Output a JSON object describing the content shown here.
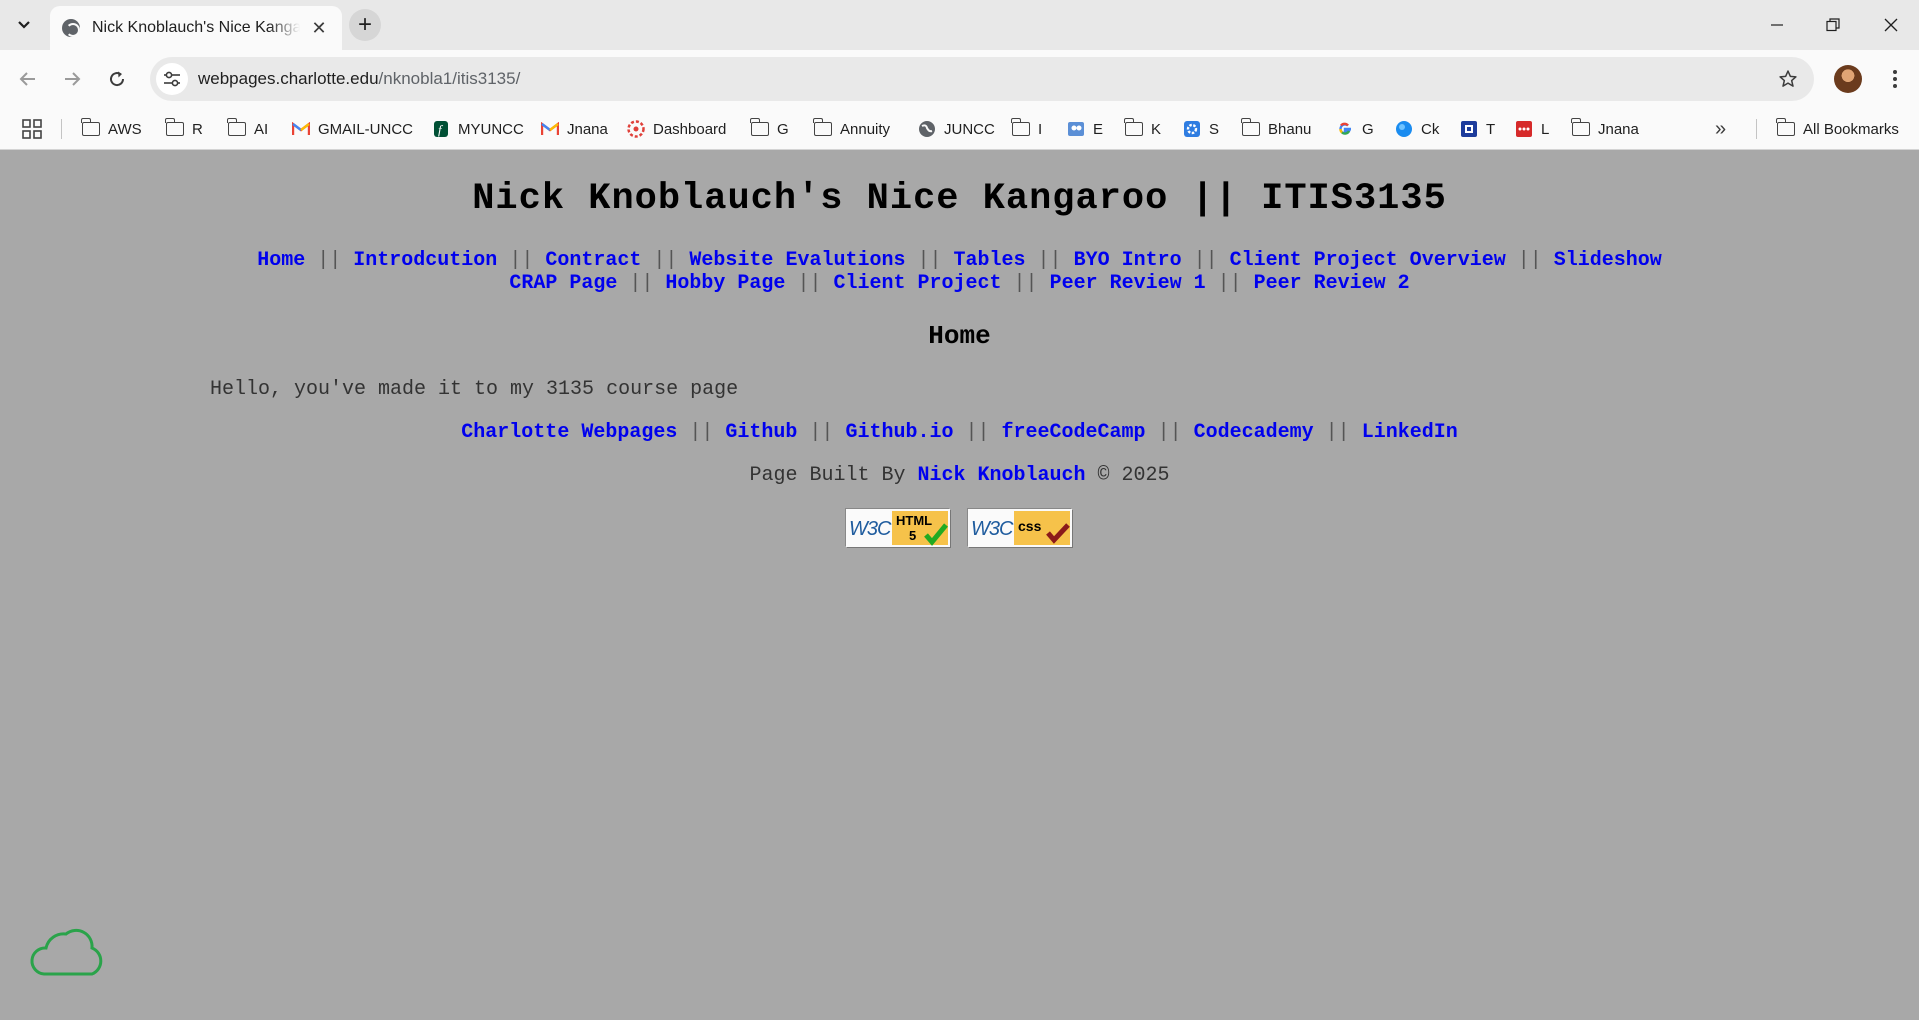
{
  "browser": {
    "tab_title": "Nick Knoblauch's Nice Kangaroo || ITIS3135",
    "url_host": "webpages.charlotte.edu",
    "url_path": "/nknobla1/itis3135/",
    "bookmarks": [
      "AWS",
      "R",
      "AI",
      "GMAIL-UNCC",
      "MYUNCC",
      "Jnana",
      "Dashboard",
      "G",
      "Annuity",
      "JUNCC",
      "I",
      "E",
      "K",
      "S",
      "Bhanu",
      "G",
      "Ck",
      "T",
      "L",
      "Jnana"
    ],
    "all_bookmarks_label": "All Bookmarks"
  },
  "page": {
    "title": "Nick Knoblauch's Nice Kangaroo || ITIS3135",
    "separator": "||",
    "nav": [
      "Home",
      "Introdcution",
      "Contract",
      "Website Evalutions",
      "Tables",
      "BYO Intro",
      "Client Project Overview",
      "Slideshow",
      "CRAP Page",
      "Hobby Page",
      "Client Project",
      "Peer Review 1",
      "Peer Review 2"
    ],
    "heading": "Home",
    "intro": "Hello, you've made it to my 3135 course page",
    "footer_links": [
      "Charlotte Webpages",
      "Github",
      "Github.io",
      "freeCodeCamp",
      "Codecademy",
      "LinkedIn"
    ],
    "built_prefix": "Page Built By",
    "built_author": "Nick Knoblauch",
    "built_suffix": "© 2025",
    "badges": {
      "html": {
        "w3c": "W3C",
        "label1": "HTML",
        "label2": "5"
      },
      "css": {
        "w3c": "W3C",
        "label": "css"
      }
    }
  },
  "colors": {
    "page_background": "#a8a8a8",
    "link": "#0000ee",
    "badge_gold": "#f6c24a",
    "w3c_blue": "#1f5c9e",
    "check_green": "#22aa22",
    "check_red": "#8b1a1a",
    "cloud_green": "#2aa34a"
  }
}
